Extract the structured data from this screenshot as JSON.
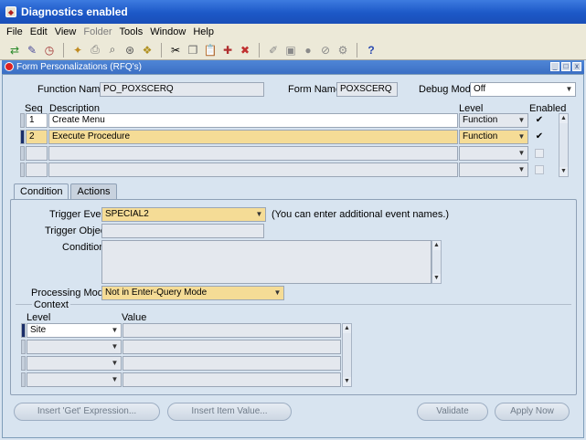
{
  "window": {
    "title": "Diagnostics enabled"
  },
  "menu": [
    {
      "label": "File",
      "disabled": false
    },
    {
      "label": "Edit",
      "disabled": false
    },
    {
      "label": "View",
      "disabled": false
    },
    {
      "label": "Folder",
      "disabled": true
    },
    {
      "label": "Tools",
      "disabled": false
    },
    {
      "label": "Window",
      "disabled": false
    },
    {
      "label": "Help",
      "disabled": false
    }
  ],
  "form": {
    "title": "Form Personalizations (RFQ's)",
    "function_name_label": "Function Name",
    "function_name": "PO_POXSCERQ",
    "form_name_label": "Form Name",
    "form_name": "POXSCERQ",
    "debug_mode_label": "Debug Mode",
    "debug_mode": "Off"
  },
  "grid": {
    "headers": {
      "seq": "Seq",
      "description": "Description",
      "level": "Level",
      "enabled": "Enabled"
    },
    "rows": [
      {
        "seq": "1",
        "description": "Create Menu",
        "level": "Function",
        "enabled": true
      },
      {
        "seq": "2",
        "description": "Execute Procedure",
        "level": "Function",
        "enabled": true
      },
      {
        "seq": "",
        "description": "",
        "level": "",
        "enabled": false
      },
      {
        "seq": "",
        "description": "",
        "level": "",
        "enabled": false
      }
    ]
  },
  "tabs": [
    "Condition",
    "Actions"
  ],
  "condition": {
    "trigger_event_label": "Trigger Event",
    "trigger_event": "SPECIAL2",
    "trigger_event_hint": "(You can enter additional event names.)",
    "trigger_object_label": "Trigger Object",
    "condition_label": "Condition",
    "processing_mode_label": "Processing Mode",
    "processing_mode": "Not in Enter-Query Mode"
  },
  "context": {
    "title": "Context",
    "level_header": "Level",
    "value_header": "Value",
    "rows": [
      {
        "level": "Site",
        "value": ""
      },
      {
        "level": "",
        "value": ""
      },
      {
        "level": "",
        "value": ""
      },
      {
        "level": "",
        "value": ""
      }
    ]
  },
  "buttons": {
    "insert_get": "Insert 'Get' Expression...",
    "insert_item": "Insert Item Value...",
    "validate": "Validate",
    "apply_now": "Apply Now"
  }
}
